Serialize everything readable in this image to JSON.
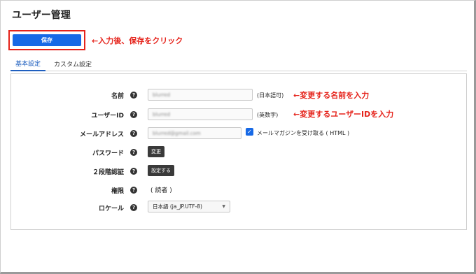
{
  "page": {
    "title": "ユーザー管理"
  },
  "toolbar": {
    "save_label": "保存"
  },
  "annotations": {
    "save": "←入力後、保存をクリック",
    "name": "←変更する名前を入力",
    "user_id": "←変更するユーザーIDを入力"
  },
  "tabs": [
    {
      "label": "基本設定",
      "active": true
    },
    {
      "label": "カスタム設定",
      "active": false
    }
  ],
  "form": {
    "name": {
      "label": "名前",
      "value": "blurred",
      "hint": "(日本語可)"
    },
    "user_id": {
      "label": "ユーザーID",
      "value": "blurred",
      "hint": "(英数字)"
    },
    "email": {
      "label": "メールアドレス",
      "value": "blurred@gmail.com",
      "checkbox_label": "メールマガジンを受け取る ( HTML )",
      "checked": true
    },
    "password": {
      "label": "パスワード",
      "button": "変更"
    },
    "two_factor": {
      "label": "２段階認証",
      "button": "設定する"
    },
    "role": {
      "label": "権限",
      "value": "( 読者 )"
    },
    "locale": {
      "label": "ロケール",
      "value": "日本語 (ja_JP.UTF-8)"
    }
  },
  "icons": {
    "help": "help-icon",
    "dropdown": "chevron-down-icon",
    "check": "check-icon"
  },
  "colors": {
    "primary": "#1769e6",
    "annotation": "#e5231b",
    "active_tab": "#1f5fbf"
  }
}
